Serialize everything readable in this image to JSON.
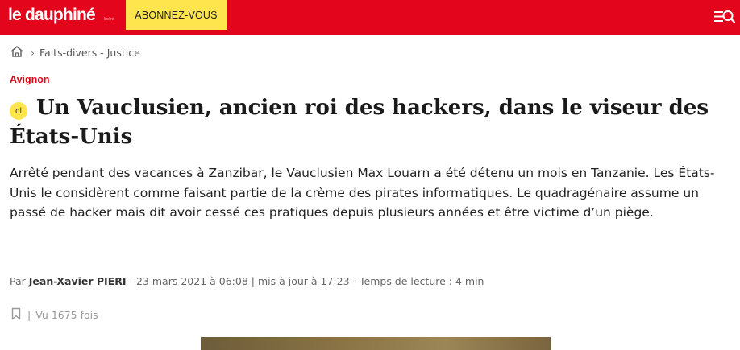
{
  "header": {
    "logo_text": "le dauphiné",
    "logo_sub": "libéré",
    "subscribe_label": "ABONNEZ-VOUS",
    "icons": [
      "menu-icon",
      "search-icon"
    ],
    "brand_color": "#e3051b",
    "accent_color": "#ffe54d"
  },
  "breadcrumb": {
    "home_icon": "home-icon",
    "section": "Faits-divers - Justice"
  },
  "article": {
    "category": "Avignon",
    "badge": "dl",
    "title": "Un Vauclusien, ancien roi des hackers, dans le viseur des États-Unis",
    "lede": "Arrêté pendant des vacances à Zanzibar, le Vauclusien Max Louarn a été détenu un mois en Tanzanie. Les États-Unis le considèrent comme faisant partie de la crème des pirates informatiques. Le quadragénaire assume un passé de hacker mais dit avoir cessé ces pratiques depuis plusieurs années et être victime d’un piège.",
    "byline_prefix": "Par",
    "author": "Jean-Xavier PIERI",
    "published": "- 23 mars 2021 à 06:08",
    "updated": "| mis à jour à 17:23",
    "reading_time": "- Temps de lecture : 4 min",
    "views_separator": "|",
    "views": "Vu 1675 fois"
  }
}
